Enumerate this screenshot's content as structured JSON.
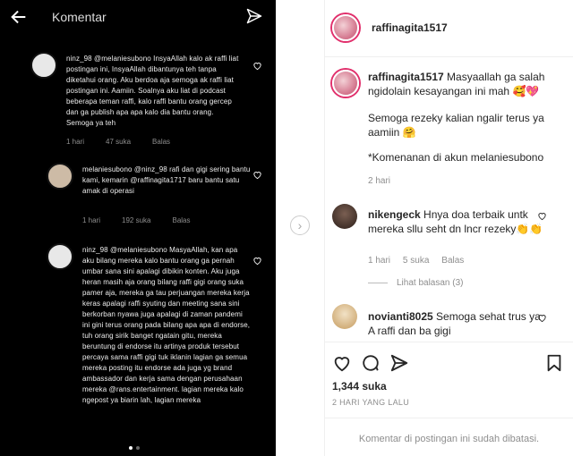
{
  "left": {
    "title": "Komentar",
    "comments": [
      {
        "text": "ninz_98 @melaniesubono InsyaAllah kalo ak raffi liat postingan ini, InsyaAllah dibantunya teh tanpa diketahui orang. Aku berdoa aja semoga ak raffi liat postingan ini. Aamiin. Soalnya aku liat di podcast beberapa teman raffi, kalo raffi bantu orang gercep dan ga publish apa apa kalo dia bantu orang. Semoga ya teh",
        "time": "1 hari",
        "likes": "47 suka",
        "reply": "Balas"
      },
      {
        "text": "melaniesubono @ninz_98 rafi dan gigi sering bantu kami, kemarin @raffinagita1717 baru bantu satu amak di operasi",
        "time": "1 hari",
        "likes": "192 suka",
        "reply": "Balas"
      },
      {
        "text": "ninz_98 @melaniesubono MasyaAllah, kan apa aku bilang mereka kalo bantu orang ga pernah umbar sana sini apalagi dibikin konten. Aku juga heran masih aja orang bilang raffi gigi orang suka pamer aja, mereka ga tau perjuangan mereka kerja keras apalagi raffi syuting dan meeting sana sini berkorban nyawa juga apalagi di zaman pandemi ini gini terus orang pada bilang apa apa di endorse, tuh orang sirik banget ngatain gitu, mereka beruntung di endorse itu artinya produk tersebut percaya sama raffi gigi tuk iklanin lagian ga semua mereka posting itu endorse ada juga yg brand ambassador dan kerja sama dengan perusahaan mereka @rans.entertainment. lagian mereka kalo ngepost ya biarin lah, lagian mereka"
      }
    ]
  },
  "right": {
    "header_username": "raffinagita1517",
    "caption": {
      "username": "raffinagita1517",
      "line1": "Masyaallah ga salah ngidolain kesayangan ini mah 🥰💖",
      "line2": "Semoga rezeky kalian ngalir terus ya aamiin 🤗",
      "line3": "*Komenanan di akun melaniesubono",
      "time": "2 hari"
    },
    "comments": [
      {
        "username": "nikengeck",
        "text": "Hnya doa terbaik untk mereka sllu seht dn lncr rezeky👏👏",
        "time": "1 hari",
        "likes": "5 suka",
        "reply": "Balas",
        "view_replies": "Lihat balasan (3)"
      },
      {
        "username": "novianti8025",
        "text": "Semoga sehat trus ya A raffi dan ba gigi"
      }
    ],
    "likes": "1,344 suka",
    "date": "2 HARI YANG LALU",
    "disabled_text": "Komentar di postingan ini sudah dibatasi."
  }
}
